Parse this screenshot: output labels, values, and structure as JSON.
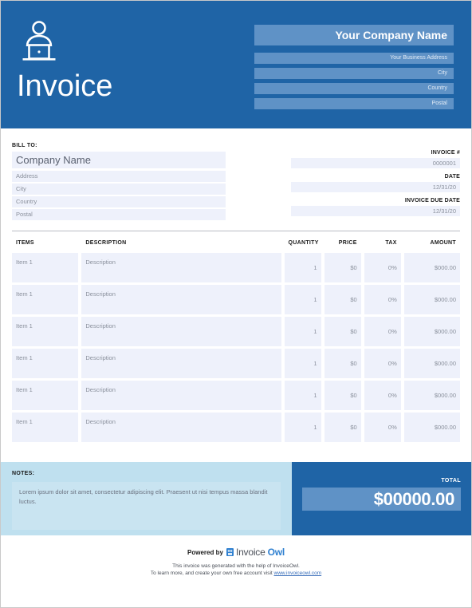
{
  "header": {
    "logo_icon": "person-at-desk-icon",
    "title": "Invoice",
    "company": {
      "name": "Your Company Name",
      "address": "Your Business Address",
      "city": "City",
      "country": "Country",
      "postal": "Postal"
    }
  },
  "bill_to": {
    "label": "BILL TO:",
    "company_name": "Company Name",
    "address": "Address",
    "city": "City",
    "country": "Country",
    "postal": "Postal"
  },
  "meta": {
    "invoice_number_label": "INVOICE #",
    "invoice_number_value": "0000001",
    "date_label": "DATE",
    "date_value": "12/31/20",
    "due_date_label": "INVOICE DUE DATE",
    "due_date_value": "12/31/20"
  },
  "table": {
    "headers": {
      "items": "ITEMS",
      "description": "DESCRIPTION",
      "quantity": "QUANTITY",
      "price": "PRICE",
      "tax": "TAX",
      "amount": "AMOUNT"
    },
    "rows": [
      {
        "item": "Item 1",
        "description": "Description",
        "quantity": "1",
        "price": "$0",
        "tax": "0%",
        "amount": "$000.00"
      },
      {
        "item": "Item 1",
        "description": "Description",
        "quantity": "1",
        "price": "$0",
        "tax": "0%",
        "amount": "$000.00"
      },
      {
        "item": "Item 1",
        "description": "Description",
        "quantity": "1",
        "price": "$0",
        "tax": "0%",
        "amount": "$000.00"
      },
      {
        "item": "Item 1",
        "description": "Description",
        "quantity": "1",
        "price": "$0",
        "tax": "0%",
        "amount": "$000.00"
      },
      {
        "item": "Item 1",
        "description": "Description",
        "quantity": "1",
        "price": "$0",
        "tax": "0%",
        "amount": "$000.00"
      },
      {
        "item": "Item 1",
        "description": "Description",
        "quantity": "1",
        "price": "$0",
        "tax": "0%",
        "amount": "$000.00"
      }
    ]
  },
  "notes": {
    "label": "NOTES:",
    "text": "Lorem ipsum dolor sit amet, consectetur adipiscing elit. Praesent ut nisi tempus massa blandit luctus."
  },
  "total": {
    "label": "TOTAL",
    "value": "$00000.00"
  },
  "footer": {
    "powered_by": "Powered by",
    "brand_icon": "owl-icon",
    "brand_first": "Invoice",
    "brand_second": "Owl",
    "line1": "This invoice was generated with the help of InvoiceOwl.",
    "line2_prefix": "To learn more, and create your own free account visit ",
    "link": "www.invoiceowl.com"
  },
  "colors": {
    "brand_blue": "#1f64a6",
    "field_blue": "#5f92c6",
    "field_lavender": "#eef1fb",
    "notes_bg": "#bfe0ef",
    "notes_box": "#c9e4f1",
    "link_blue": "#3a6fba"
  }
}
